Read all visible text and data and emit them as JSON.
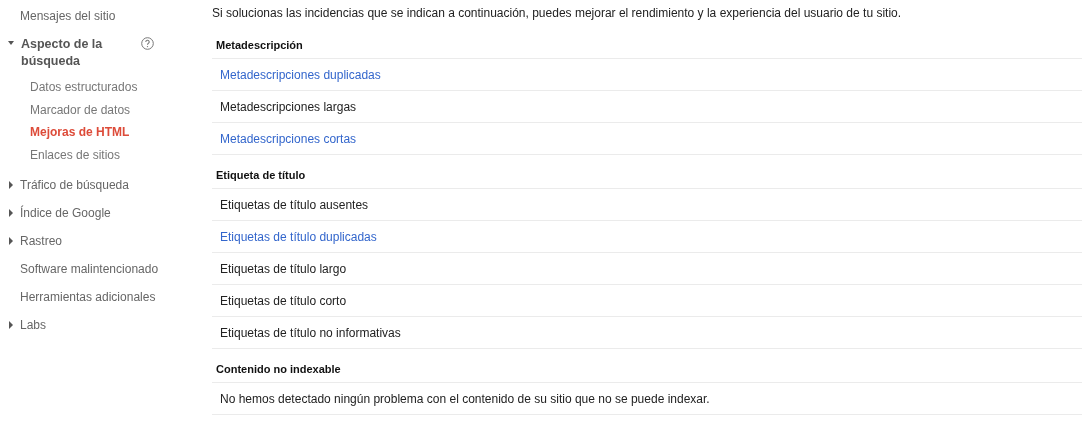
{
  "sidebar": {
    "items": [
      {
        "label": "Mensajes del sitio",
        "kind": "plain"
      },
      {
        "label": "Aspecto de la búsqueda",
        "kind": "group",
        "expanded": true,
        "children": [
          {
            "label": "Datos estructurados",
            "selected": false
          },
          {
            "label": "Marcador de datos",
            "selected": false
          },
          {
            "label": "Mejoras de HTML",
            "selected": true
          },
          {
            "label": "Enlaces de sitios",
            "selected": false
          }
        ]
      },
      {
        "label": "Tráfico de búsqueda",
        "kind": "group",
        "expanded": false
      },
      {
        "label": "Índice de Google",
        "kind": "group",
        "expanded": false
      },
      {
        "label": "Rastreo",
        "kind": "group",
        "expanded": false
      },
      {
        "label": "Software malintencionado",
        "kind": "plain"
      },
      {
        "label": "Herramientas adicionales",
        "kind": "plain"
      },
      {
        "label": "Labs",
        "kind": "group",
        "expanded": false
      }
    ]
  },
  "intro": "Si solucionas las incidencias que se indican a continuación, puedes mejorar el rendimiento y la experiencia del usuario de tu sitio.",
  "sections": [
    {
      "title": "Metadescripción",
      "rows": [
        {
          "text": "Metadescripciones duplicadas",
          "link": true
        },
        {
          "text": "Metadescripciones largas",
          "link": false
        },
        {
          "text": "Metadescripciones cortas",
          "link": true
        }
      ]
    },
    {
      "title": "Etiqueta de título",
      "rows": [
        {
          "text": "Etiquetas de título ausentes",
          "link": false
        },
        {
          "text": "Etiquetas de título duplicadas",
          "link": true
        },
        {
          "text": "Etiquetas de título largo",
          "link": false
        },
        {
          "text": "Etiquetas de título corto",
          "link": false
        },
        {
          "text": "Etiquetas de título no informativas",
          "link": false
        }
      ]
    },
    {
      "title": "Contenido no indexable",
      "rows": [
        {
          "text": "No hemos detectado ningún problema con el contenido de su sitio que no se puede indexar.",
          "link": false
        }
      ]
    }
  ]
}
